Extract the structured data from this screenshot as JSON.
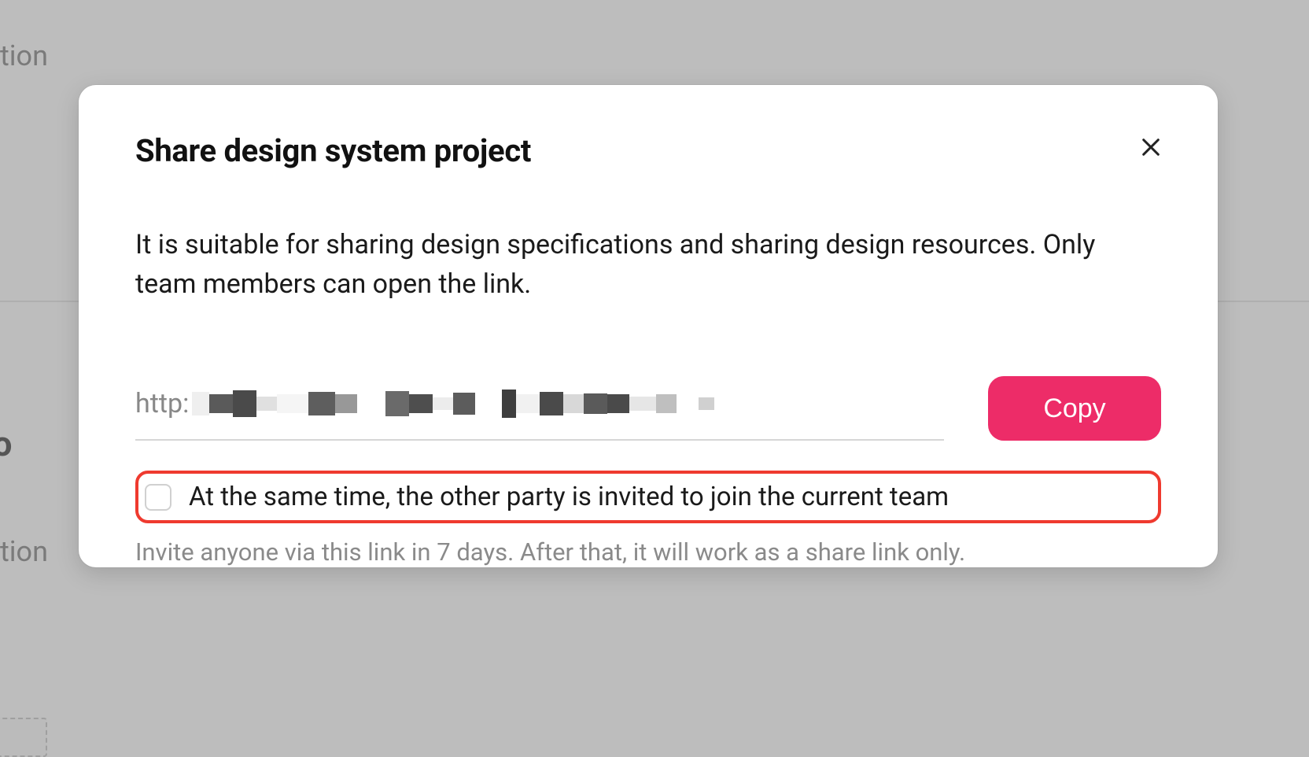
{
  "background": {
    "text1": "cription",
    "text2": " gro",
    "text3": "cription"
  },
  "modal": {
    "title": "Share design system project",
    "description": "It is suitable for sharing design specifications and sharing design resources. Only team members can open the link.",
    "link_prefix": "http:",
    "copy_label": "Copy",
    "checkbox_label": "At the same time, the other party is invited to join the current team",
    "checkbox_checked": false,
    "hint": "Invite anyone via this link in 7 days. After that, it will work as a share link only."
  }
}
